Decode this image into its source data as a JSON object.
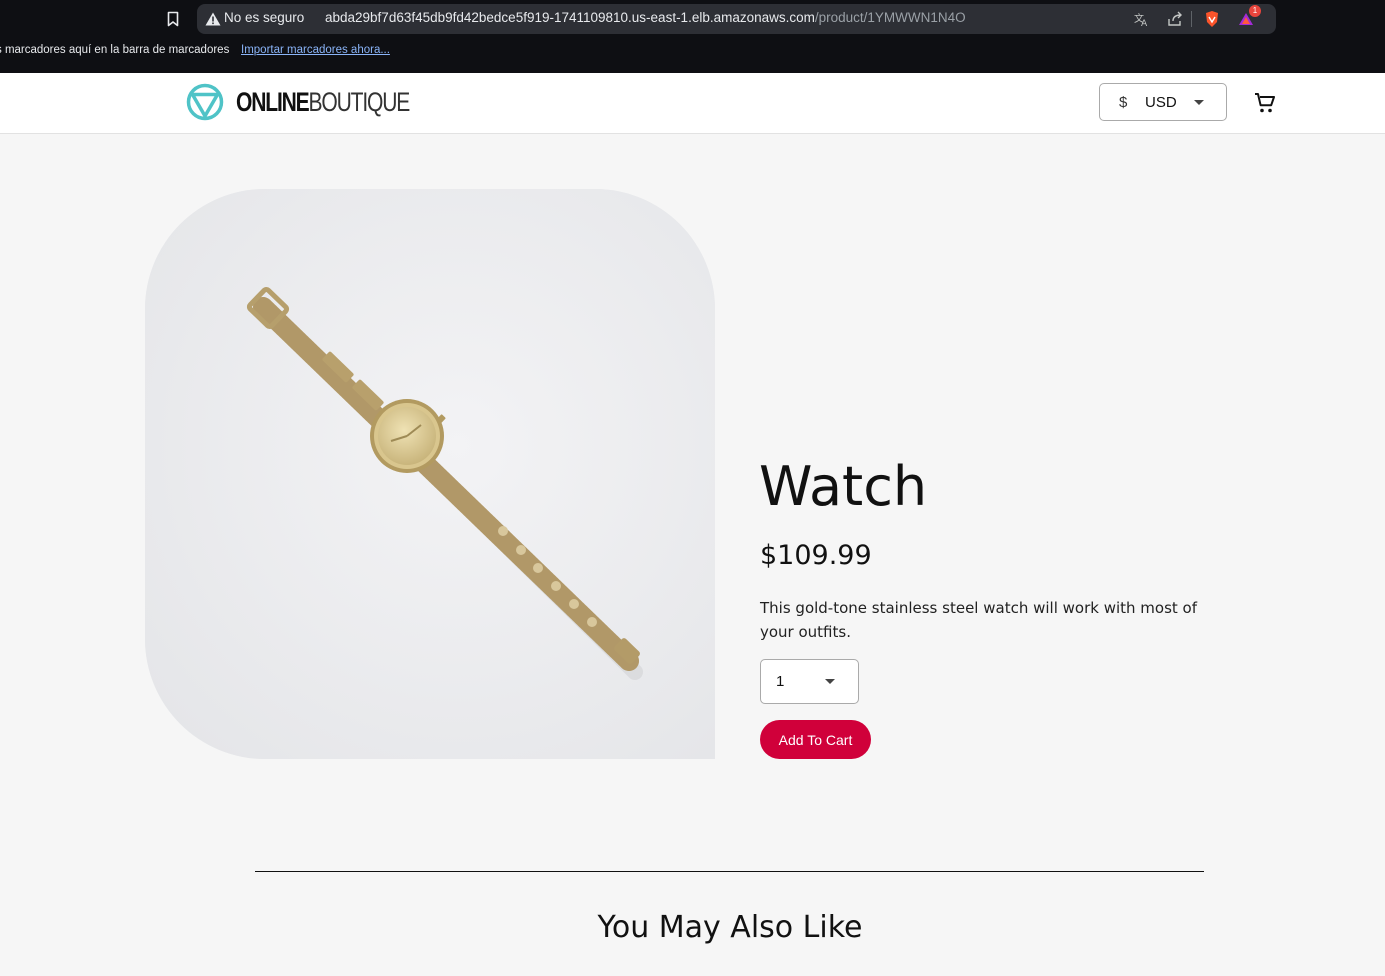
{
  "browser": {
    "security_label": "No es seguro",
    "url_host": "abda29bf7d63f45db9fd42bedce5f919-1741109810.us-east-1.elb.amazonaws.com",
    "url_path": "/product/1YMWWN1N4O",
    "extension_badge": "1",
    "bookmarks_bar_text": "s marcadores aquí en la barra de marcadores",
    "bookmarks_import_link": "Importar marcadores ahora..."
  },
  "header": {
    "logo_bold": "ONLINE",
    "logo_light": "BOUTIQUE",
    "currency_symbol": "$",
    "currency_code": "USD"
  },
  "product": {
    "name": "Watch",
    "price": "$109.99",
    "description": "This gold-tone stainless steel watch will work with most of your outfits.",
    "quantity": "1",
    "add_to_cart_label": "Add To Cart"
  },
  "recommendations": {
    "title": "You May Also Like"
  },
  "colors": {
    "brand_teal": "#4fc3c7",
    "cart_button": "#d0003a",
    "page_background": "#f6f6f6"
  }
}
